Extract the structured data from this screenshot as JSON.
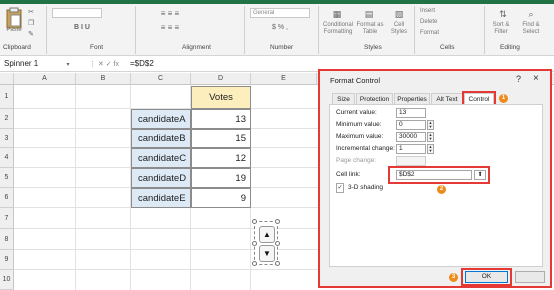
{
  "ribbon": {
    "clipboard": {
      "paste_label": "Paste",
      "group_label": "Clipboard"
    },
    "font": {
      "group_label": "Font"
    },
    "alignment": {
      "group_label": "Alignment"
    },
    "number": {
      "format_value": "General",
      "group_label": "Number"
    },
    "styles": {
      "conditional_label": "Conditional Formatting",
      "format_table_label": "Format as Table",
      "cell_styles_label": "Cell Styles",
      "group_label": "Styles"
    },
    "cells": {
      "insert_label": "Insert",
      "delete_label": "Delete",
      "format_label": "Format",
      "group_label": "Cells"
    },
    "editing": {
      "sort_label": "Sort & Filter",
      "find_label": "Find & Select",
      "group_label": "Editing"
    }
  },
  "formula_bar": {
    "name_box": "Spinner 1",
    "formula": "=$D$2"
  },
  "columns": [
    "A",
    "B",
    "C",
    "D",
    "E"
  ],
  "rows": [
    "1",
    "2",
    "3",
    "4",
    "5",
    "6",
    "7",
    "8",
    "9",
    "10"
  ],
  "table": {
    "header": "Votes",
    "rows": [
      {
        "name": "candidateA",
        "votes": "13"
      },
      {
        "name": "candidateB",
        "votes": "15"
      },
      {
        "name": "candidateC",
        "votes": "12"
      },
      {
        "name": "candidateD",
        "votes": "19"
      },
      {
        "name": "candidateE",
        "votes": "9"
      }
    ]
  },
  "spinner": {
    "up_icon": "triangle-up",
    "down_icon": "triangle-down"
  },
  "dialog": {
    "title": "Format Control",
    "help": "?",
    "close": "×",
    "tabs": [
      "Size",
      "Protection",
      "Properties",
      "Alt Text",
      "Control"
    ],
    "active_tab": "Control",
    "fields": {
      "current_value_label": "Current value:",
      "current_value": "13",
      "minimum_value_label": "Minimum value:",
      "minimum_value": "0",
      "maximum_value_label": "Maximum value:",
      "maximum_value": "30000",
      "incremental_change_label": "Incremental change:",
      "incremental_change": "1",
      "page_change_label": "Page change:",
      "cell_link_label": "Cell link:",
      "cell_link": "$D$2",
      "shading_label": "3-D shading",
      "shading_checked": true
    },
    "ok_label": "OK",
    "badges": [
      "1",
      "2",
      "3"
    ],
    "highlight_color": "#e53935",
    "badge_color": "#ef8b1b"
  }
}
